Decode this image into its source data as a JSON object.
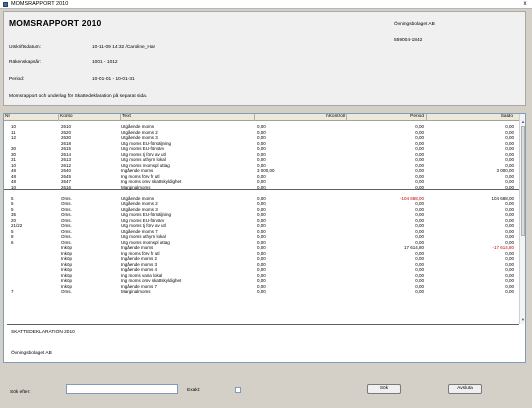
{
  "window": {
    "title": "MOMSRAPPORT 2010",
    "close_glyph": "x"
  },
  "header": {
    "report_title": "MOMSRAPPORT 2010",
    "company": "Övningsbolaget AB",
    "org_number": "559004-1842",
    "rows": [
      {
        "label": "Utskriftsdatum:",
        "value": "10-11-09   14:32   /Caroline_Har"
      },
      {
        "label": "Räkenskapsår:",
        "value": "1001 - 1012"
      },
      {
        "label": "Period:",
        "value": "10-01-01 - 10-01-31"
      }
    ],
    "note": "Momsrapport och underlag för Skattedeklaration på separat sida."
  },
  "grid": {
    "columns": {
      "nr": "Nr",
      "konto": "Konto",
      "text": "Text",
      "ik": "I\\Kontroll",
      "period": "Period",
      "saldo": "Saldo"
    },
    "rows": [
      {
        "nr": "10",
        "konto": "2610",
        "text": "Utgående moms",
        "ik": "0,00",
        "period": "0,00",
        "saldo": "0,00"
      },
      {
        "nr": "11",
        "konto": "2620",
        "text": "Utgående moms 2",
        "ik": "0,00",
        "period": "0,00",
        "saldo": "0,00"
      },
      {
        "nr": "12",
        "konto": "2630",
        "text": "Utgående moms 3",
        "ik": "0,00",
        "period": "0,00",
        "saldo": "0,00"
      },
      {
        "nr": "",
        "konto": "2618",
        "text": "Utg moms EU-försäljning",
        "ik": "0,00",
        "period": "0,00",
        "saldo": "0,00"
      },
      {
        "nr": "30",
        "konto": "2615",
        "text": "Utg moms EU-förvärv",
        "ik": "0,00",
        "period": "0,00",
        "saldo": "0,00"
      },
      {
        "nr": "30",
        "konto": "2614",
        "text": "Utg moms tj förv av utl",
        "ik": "0,00",
        "period": "0,00",
        "saldo": "0,00"
      },
      {
        "nr": "31",
        "konto": "2613",
        "text": "Utg moms uthyrn lokal",
        "ik": "0,00",
        "period": "0,00",
        "saldo": "0,00"
      },
      {
        "nr": "10",
        "konto": "2612",
        "text": "Utg moms momspl uttag",
        "ik": "0,00",
        "period": "0,00",
        "saldo": "0,00"
      },
      {
        "nr": "48",
        "konto": "2640",
        "text": "Ingående moms",
        "ik": "3 000,00",
        "period": "0,00",
        "saldo": "3 000,00"
      },
      {
        "nr": "48",
        "konto": "2645",
        "text": "Ing moms förv fr utl",
        "ik": "0,00",
        "period": "0,00",
        "saldo": "0,00"
      },
      {
        "nr": "48",
        "konto": "2647",
        "text": "Ing moms omv skattskyldighet",
        "ik": "0,00",
        "period": "0,00",
        "saldo": "0,00"
      },
      {
        "nr": "10",
        "konto": "2616",
        "text": "Marginalmoms",
        "ik": "0,00",
        "period": "0,00",
        "saldo": "0,00",
        "sep": true
      },
      {
        "nr": "",
        "konto": "",
        "text": "",
        "ik": "",
        "period": "",
        "saldo": ""
      },
      {
        "nr": "5",
        "konto": "Oms.",
        "text": "Utgående moms",
        "ik": "0,00",
        "period": "-104 688,00",
        "saldo": "104 688,00",
        "period_neg": true
      },
      {
        "nr": "5",
        "konto": "Oms.",
        "text": "Utgående moms 2",
        "ik": "0,00",
        "period": "0,00",
        "saldo": "0,00"
      },
      {
        "nr": "5",
        "konto": "Oms.",
        "text": "Utgående moms 3",
        "ik": "0,00",
        "period": "0,00",
        "saldo": "0,00"
      },
      {
        "nr": "35",
        "konto": "Oms.",
        "text": "Utg moms EU-försäljning",
        "ik": "0,00",
        "period": "0,00",
        "saldo": "0,00"
      },
      {
        "nr": "20",
        "konto": "Oms.",
        "text": "Utg moms EU-förvärv",
        "ik": "0,00",
        "period": "0,00",
        "saldo": "0,00"
      },
      {
        "nr": "21/22",
        "konto": "Oms.",
        "text": "Utg moms tj förv av utl",
        "ik": "0,00",
        "period": "0,00",
        "saldo": "0,00"
      },
      {
        "nr": "5",
        "konto": "Oms.",
        "text": "Utgående moms 7",
        "ik": "0,00",
        "period": "0,00",
        "saldo": "0,00"
      },
      {
        "nr": "8",
        "konto": "Oms.",
        "text": "Utg moms uthyrn lokal",
        "ik": "0,00",
        "period": "0,00",
        "saldo": "0,00"
      },
      {
        "nr": "6",
        "konto": "Oms.",
        "text": "Utg moms momspl uttag",
        "ik": "0,00",
        "period": "0,00",
        "saldo": "0,00"
      },
      {
        "nr": "",
        "konto": "Inköp",
        "text": "Ingående moms",
        "ik": "0,00",
        "period": "17 614,80",
        "saldo": "-17 614,80",
        "saldo_neg": true
      },
      {
        "nr": "",
        "konto": "Inköp",
        "text": "Ing moms förv fr utl",
        "ik": "0,00",
        "period": "0,00",
        "saldo": "0,00"
      },
      {
        "nr": "",
        "konto": "Inköp",
        "text": "Ingående moms 2",
        "ik": "0,00",
        "period": "0,00",
        "saldo": "0,00"
      },
      {
        "nr": "",
        "konto": "Inköp",
        "text": "Ingående moms 3",
        "ik": "0,00",
        "period": "0,00",
        "saldo": "0,00"
      },
      {
        "nr": "",
        "konto": "Inköp",
        "text": "Ingående moms 4",
        "ik": "0,00",
        "period": "0,00",
        "saldo": "0,00"
      },
      {
        "nr": "",
        "konto": "Inköp",
        "text": "Ing moms varia lokal",
        "ik": "0,00",
        "period": "0,00",
        "saldo": "0,00"
      },
      {
        "nr": "",
        "konto": "Inköp",
        "text": "Ing moms omv skattskyldighet",
        "ik": "0,00",
        "period": "0,00",
        "saldo": "0,00"
      },
      {
        "nr": "",
        "konto": "Inköp",
        "text": "Ingående moms 7",
        "ik": "0,00",
        "period": "0,00",
        "saldo": "0,00"
      },
      {
        "nr": "7",
        "konto": "Oms.",
        "text": "Marginalmoms",
        "ik": "0,00",
        "period": "0,00",
        "saldo": "0,00"
      }
    ],
    "footer": {
      "line1": "SKATTEDEKLARATION 2010",
      "line2": "Övningsbolaget AB"
    }
  },
  "bottom": {
    "search_label": "Sök efter:",
    "search_value": "",
    "exact_label": "Exakt:",
    "search_button": "Sök",
    "cancel_button": "Avsluta"
  }
}
